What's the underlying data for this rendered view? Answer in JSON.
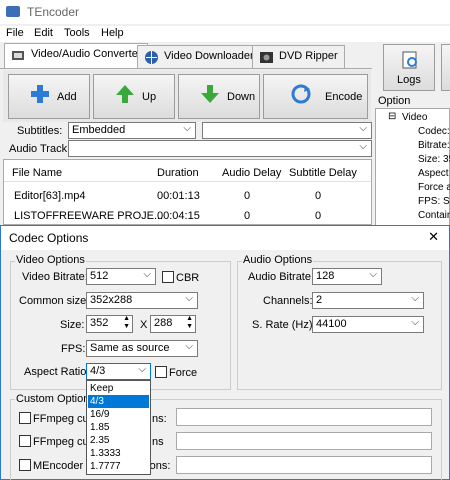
{
  "app": {
    "title": "TEncoder"
  },
  "menu": [
    "File",
    "Edit",
    "Tools",
    "Help"
  ],
  "tabs": [
    "Video/Audio Converter",
    "Video Downloader",
    "DVD Ripper"
  ],
  "toolbar": {
    "add": "Add",
    "up": "Up",
    "down": "Down",
    "encode": "Encode"
  },
  "logs_label": "Logs",
  "subtitles": {
    "label": "Subtitles:",
    "value": "Embedded"
  },
  "audio_track": {
    "label": "Audio Track:"
  },
  "file_list": {
    "headers": [
      "File Name",
      "Duration",
      "Audio Delay",
      "Subtitle Delay"
    ],
    "rows": [
      [
        "Editor[63].mp4",
        "00:01:13",
        "0",
        "0"
      ],
      [
        "LISTOFFREEWARE PROJE...",
        "00:04:15",
        "0",
        "0"
      ]
    ]
  },
  "option_summary": {
    "title": "Option summary:",
    "root": "Video",
    "items": [
      "Codec:",
      "Bitrate:",
      "Size: 35",
      "Aspect",
      "Force a",
      "FPS: Sa",
      "Contain"
    ]
  },
  "dialog": {
    "title": "Codec Options",
    "close": "✕",
    "video_options": {
      "title": "Video Options",
      "bitrate_label": "Video Bitrate:",
      "bitrate_value": "512",
      "cbr_label": "CBR",
      "common_sizes_label": "Common sizes:",
      "common_sizes_value": "352x288",
      "size_label": "Size:",
      "size_w": "352",
      "size_x": "X",
      "size_h": "288",
      "fps_label": "FPS:",
      "fps_value": "Same as source",
      "aspect_label": "Aspect Ratio:",
      "aspect_value": "4/3",
      "force_label": "Force"
    },
    "audio_options": {
      "title": "Audio Options",
      "bitrate_label": "Audio Bitrate:",
      "bitrate_value": "128",
      "channels_label": "Channels:",
      "channels_value": "2",
      "rate_label": "S. Rate (Hz):",
      "rate_value": "44100"
    },
    "custom_options": {
      "title": "Custom Options",
      "items": [
        "FFmpeg cust",
        "FFmpeg cust",
        "MEncoder cu"
      ],
      "suffixes": [
        "ns:",
        "ns",
        "ptions:"
      ]
    },
    "aspect_dropdown": {
      "options": [
        "Keep",
        "4/3",
        "16/9",
        "1.85",
        "2.35",
        "1.3333",
        "1.7777"
      ],
      "selected_index": 1
    }
  },
  "colors": {
    "accent": "#0078d7",
    "border": "#2a7ad2"
  }
}
